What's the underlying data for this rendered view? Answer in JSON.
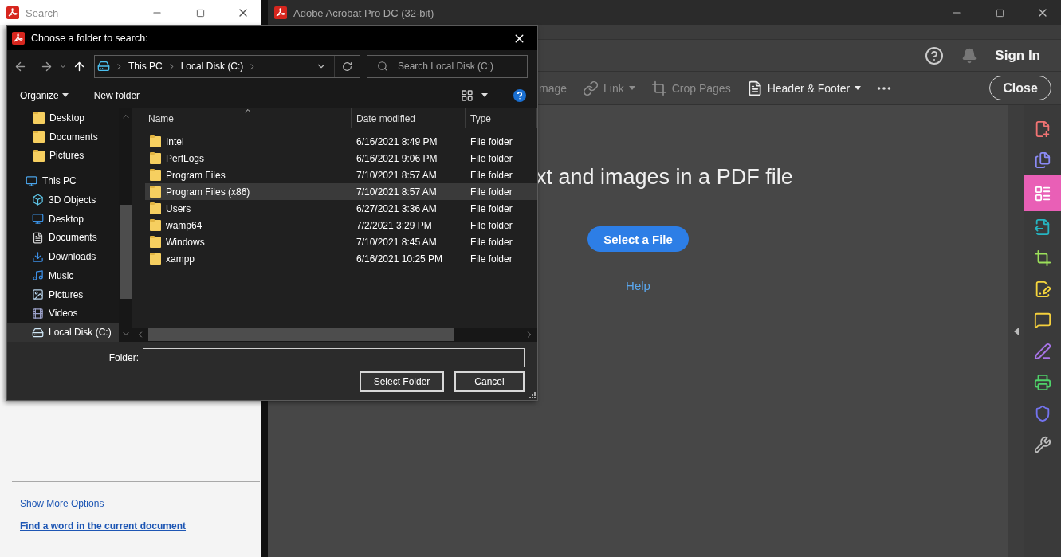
{
  "search_window": {
    "title": "Search",
    "links": [
      {
        "label": "Show More Options",
        "bold": false
      },
      {
        "label": "Find a word in the current document",
        "bold": true
      }
    ]
  },
  "acrobat": {
    "title": "Adobe Acrobat Pro DC (32-bit)",
    "sign_in": "Sign In",
    "tools": [
      {
        "label": "mage",
        "kind": "image",
        "disabled": true,
        "dropdown": false
      },
      {
        "label": "Link",
        "kind": "link",
        "disabled": true,
        "dropdown": true
      },
      {
        "label": "Crop Pages",
        "kind": "crop",
        "disabled": true,
        "dropdown": false
      },
      {
        "label": "Header & Footer",
        "kind": "page",
        "disabled": false,
        "dropdown": true
      }
    ],
    "close_button": "Close",
    "heading": "xt and images in a PDF file",
    "select_button": "Select a File",
    "help_link": "Help",
    "rail": [
      {
        "kind": "create",
        "color": "#f07373",
        "selected": false
      },
      {
        "kind": "combine",
        "color": "#8b8bf5",
        "selected": false
      },
      {
        "kind": "organize",
        "color": "#ffffff",
        "selected": true
      },
      {
        "kind": "export",
        "color": "#26b5c2",
        "selected": false
      },
      {
        "kind": "crop",
        "color": "#9ce05a",
        "selected": false
      },
      {
        "kind": "note",
        "color": "#f5d53d",
        "selected": false
      },
      {
        "kind": "comment",
        "color": "#f5d03d",
        "selected": false
      },
      {
        "kind": "sign",
        "color": "#a874e8",
        "selected": false
      },
      {
        "kind": "print",
        "color": "#4fd36a",
        "selected": false
      },
      {
        "kind": "protect",
        "color": "#7474f0",
        "selected": false
      },
      {
        "kind": "tools",
        "color": "#bdbdbd",
        "selected": false
      }
    ]
  },
  "dialog": {
    "title": "Choose a folder to search:",
    "breadcrumb": [
      "This PC",
      "Local Disk (C:)"
    ],
    "search_placeholder": "Search Local Disk (C:)",
    "commands": [
      {
        "label": "Organize",
        "dropdown": true
      },
      {
        "label": "New folder",
        "dropdown": false
      }
    ],
    "quick_access": [
      {
        "label": "Desktop",
        "kind": "folder",
        "selected": false
      },
      {
        "label": "Documents",
        "kind": "folder",
        "selected": false
      },
      {
        "label": "Pictures",
        "kind": "folder",
        "selected": false
      }
    ],
    "tree": [
      {
        "label": "This PC",
        "kind": "pc",
        "selected": false,
        "children": [
          {
            "label": "3D Objects",
            "kind": "objects",
            "selected": false
          },
          {
            "label": "Desktop",
            "kind": "desktop",
            "selected": false
          },
          {
            "label": "Documents",
            "kind": "documents",
            "selected": false
          },
          {
            "label": "Downloads",
            "kind": "downloads",
            "selected": false
          },
          {
            "label": "Music",
            "kind": "music",
            "selected": false
          },
          {
            "label": "Pictures",
            "kind": "pictures",
            "selected": false
          },
          {
            "label": "Videos",
            "kind": "videos",
            "selected": false
          },
          {
            "label": "Local Disk (C:)",
            "kind": "drive",
            "selected": true
          }
        ]
      }
    ],
    "columns": [
      "Name",
      "Date modified",
      "Type"
    ],
    "rows": [
      {
        "name": "Intel",
        "date": "6/16/2021 8:49 PM",
        "type": "File folder",
        "selected": false
      },
      {
        "name": "PerfLogs",
        "date": "6/16/2021 9:06 PM",
        "type": "File folder",
        "selected": false
      },
      {
        "name": "Program Files",
        "date": "7/10/2021 8:57 AM",
        "type": "File folder",
        "selected": false
      },
      {
        "name": "Program Files (x86)",
        "date": "7/10/2021 8:57 AM",
        "type": "File folder",
        "selected": true
      },
      {
        "name": "Users",
        "date": "6/27/2021 3:36 AM",
        "type": "File folder",
        "selected": false
      },
      {
        "name": "wamp64",
        "date": "7/2/2021 3:29 PM",
        "type": "File folder",
        "selected": false
      },
      {
        "name": "Windows",
        "date": "7/10/2021 8:45 AM",
        "type": "File folder",
        "selected": false
      },
      {
        "name": "xampp",
        "date": "6/16/2021 10:25 PM",
        "type": "File folder",
        "selected": false
      }
    ],
    "folder_label": "Folder:",
    "buttons": [
      "Select Folder",
      "Cancel"
    ]
  }
}
